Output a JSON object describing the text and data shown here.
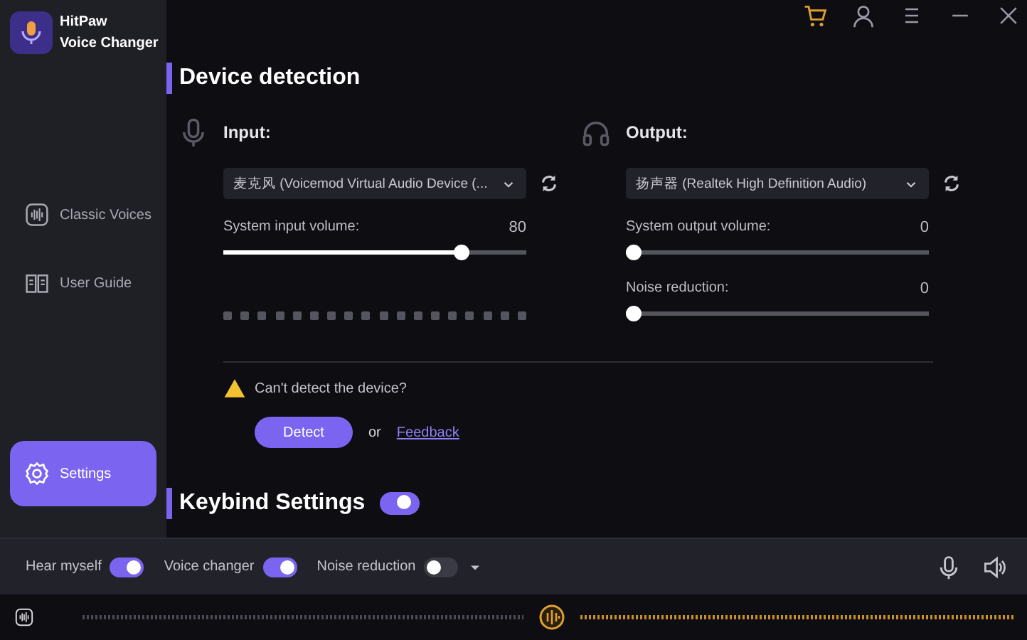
{
  "app": {
    "name": "HitPaw",
    "subtitle": "Voice Changer"
  },
  "sidebar": {
    "items": [
      {
        "kind": "voices",
        "label": "Classic Voices",
        "selected": false
      },
      {
        "kind": "guide",
        "label": "User Guide",
        "selected": false
      },
      {
        "kind": "settings",
        "label": "Settings",
        "selected": true
      }
    ]
  },
  "device_detection": {
    "title": "Device detection",
    "columns": [
      {
        "kind": "input",
        "label": "Input:",
        "device": "麦克风 (Voicemod Virtual Audio Device (...",
        "meter": true,
        "sliders": [
          {
            "label": "System input volume:",
            "reading": "80",
            "level": 0.8
          }
        ]
      },
      {
        "kind": "output",
        "label": "Output:",
        "device": "扬声器 (Realtek High Definition Audio)",
        "meter": false,
        "sliders": [
          {
            "label": "System output volume:",
            "reading": "0",
            "level": 0
          },
          {
            "label": "Noise reduction:",
            "reading": "0",
            "level": 0
          }
        ]
      }
    ],
    "warning": "Can't detect the device?",
    "detect_button": "Detect",
    "separator": "or",
    "feedback_link": "Feedback"
  },
  "keybind": {
    "title": "Keybind Settings",
    "on": true
  },
  "bottom_bar": {
    "toggles": [
      {
        "label": "Hear myself",
        "on": true,
        "dropdown": false
      },
      {
        "label": "Voice changer",
        "on": true,
        "dropdown": false
      },
      {
        "label": "Noise reduction",
        "on": false,
        "dropdown": true
      }
    ]
  }
}
